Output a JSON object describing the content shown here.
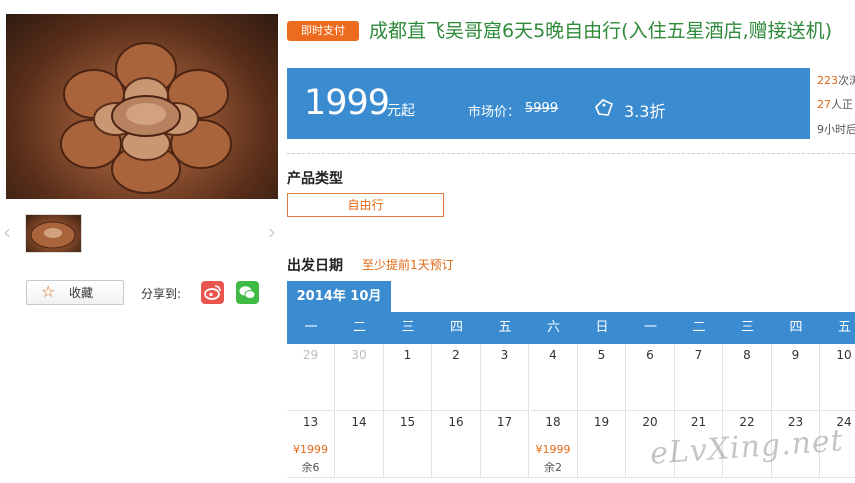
{
  "gallery": {
    "prev_arrow": "‹",
    "next_arrow": "›"
  },
  "actions": {
    "favorite_label": "收藏",
    "share_label": "分享到:",
    "share_targets": [
      "weibo-icon",
      "wechat-icon"
    ]
  },
  "product": {
    "pay_badge": "即时支付",
    "title": "成都直飞吴哥窟6天5晚自由行(入住五星酒店,赠接送机)",
    "price": "1999",
    "price_unit": "元起",
    "market_label": "市场价：",
    "market_price": "5999",
    "discount": "3.3折",
    "stats": [
      {
        "num": "223",
        "text": "次浏"
      },
      {
        "num": "27",
        "text": "人正"
      },
      {
        "num": "",
        "text": "9小时后"
      }
    ],
    "type_label": "产品类型",
    "type_value": "自由行",
    "depart_label": "出发日期",
    "depart_note": "至少提前1天预订"
  },
  "calendar": {
    "month": "2014年 10月",
    "weekdays": [
      "一",
      "二",
      "三",
      "四",
      "五",
      "六",
      "日",
      "一",
      "二",
      "三",
      "四",
      "五"
    ],
    "rows": [
      [
        {
          "d": "29",
          "other": true
        },
        {
          "d": "30",
          "other": true
        },
        {
          "d": "1"
        },
        {
          "d": "2"
        },
        {
          "d": "3"
        },
        {
          "d": "4"
        },
        {
          "d": "5"
        },
        {
          "d": "6"
        },
        {
          "d": "7"
        },
        {
          "d": "8"
        },
        {
          "d": "9"
        },
        {
          "d": "10"
        }
      ],
      [
        {
          "d": "13",
          "price": "¥1999",
          "rest": "余6"
        },
        {
          "d": "14"
        },
        {
          "d": "15"
        },
        {
          "d": "16"
        },
        {
          "d": "17"
        },
        {
          "d": "18",
          "price": "¥1999",
          "rest": "余2"
        },
        {
          "d": "19"
        },
        {
          "d": "20"
        },
        {
          "d": "21"
        },
        {
          "d": "22"
        },
        {
          "d": "23"
        },
        {
          "d": "24"
        }
      ]
    ]
  },
  "watermark": "eLvXing.net",
  "colors": {
    "accent_blue": "#3a8bd0",
    "accent_orange": "#e06a17",
    "title_green": "#2f8a3a"
  }
}
